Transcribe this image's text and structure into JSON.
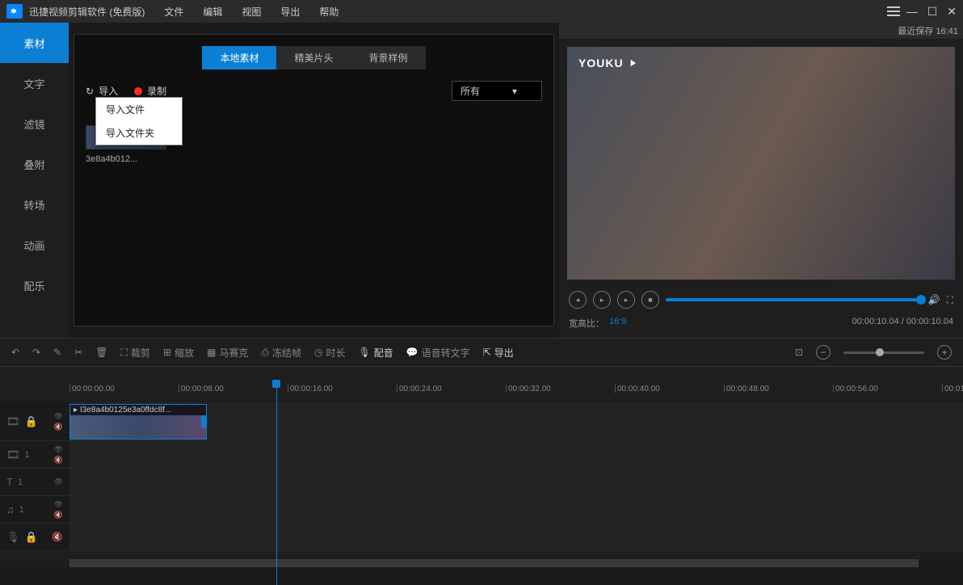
{
  "titlebar": {
    "title": "迅捷视频剪辑软件 (免费版)"
  },
  "menubar": [
    "文件",
    "编辑",
    "视图",
    "导出",
    "帮助"
  ],
  "left_tabs": [
    "素材",
    "文字",
    "滤镜",
    "叠附",
    "转场",
    "动画",
    "配乐"
  ],
  "media_tabs": [
    "本地素材",
    "精美片头",
    "背景样例"
  ],
  "import_label": "导入",
  "record_label": "录制",
  "filter_label": "所有",
  "import_menu": [
    "导入文件",
    "导入文件夹"
  ],
  "thumb_name": "3e8a4b012...",
  "preview": {
    "save_label": "最近保存 16:41",
    "logo": "YOUKU",
    "aspect_label": "宽高比：",
    "aspect_value": "16:9",
    "time_current": "00:00:10.04",
    "time_total": "00:00:10.04"
  },
  "mid_tools": {
    "crop": "裁剪",
    "scale": "缩放",
    "mosaic": "马赛克",
    "freeze": "冻结帧",
    "duration": "时长",
    "audio": "配音",
    "stt": "语音转文字",
    "export": "导出"
  },
  "ruler_marks": [
    "00:00:00.00",
    "00:00:08.00",
    "00:00:16.00",
    "00:00:24.00",
    "00:00:32.00",
    "00:00:40.00",
    "00:00:48.00",
    "00:00:56.00",
    "00:01"
  ],
  "clip_label": "I3e8a4b0125e3a0ffdc8f...",
  "track_num": "1"
}
